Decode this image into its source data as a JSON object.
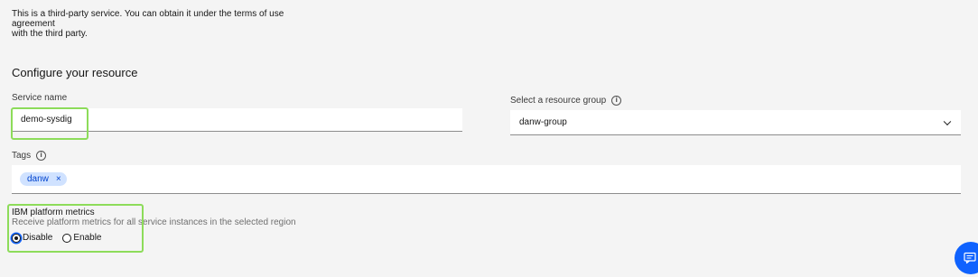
{
  "intro": {
    "line1": "This is a third-party service. You can obtain it under the terms of use agreement",
    "line2": "with the third party."
  },
  "section_title": "Configure your resource",
  "service_name": {
    "label": "Service name",
    "value": "demo-sysdig"
  },
  "resource_group": {
    "label": "Select a resource group",
    "value": "danw-group",
    "info_icon": "info-icon",
    "dropdown_icon": "chevron-down-icon"
  },
  "tags": {
    "label": "Tags",
    "items": [
      {
        "label": "danw",
        "remove_glyph": "×"
      }
    ]
  },
  "platform_metrics": {
    "label": "IBM platform metrics",
    "description": "Receive platform metrics for all service instances in the selected region",
    "options": [
      {
        "label": "Disable",
        "selected": true
      },
      {
        "label": "Enable",
        "selected": false
      }
    ]
  },
  "chat_button": {
    "icon": "chat-icon"
  },
  "colors": {
    "highlight": "#8ddc5a",
    "tag_bg": "#d0e2ff",
    "tag_text": "#0043ce",
    "accent": "#0f62fe"
  }
}
